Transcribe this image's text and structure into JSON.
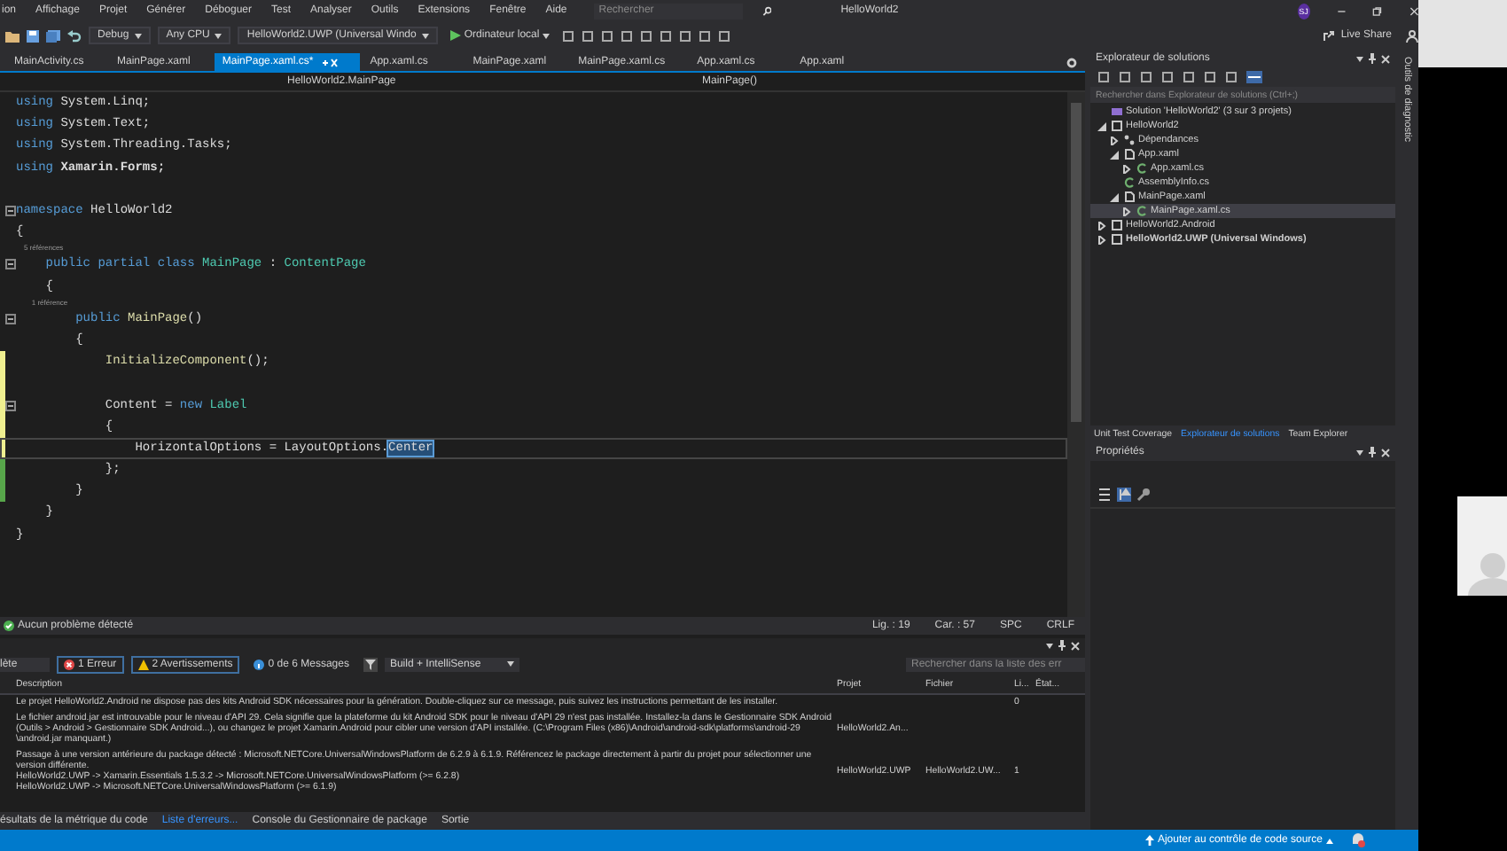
{
  "menu": {
    "items": [
      "ion",
      "Affichage",
      "Projet",
      "Générer",
      "Déboguer",
      "Test",
      "Analyser",
      "Outils",
      "Extensions",
      "Fenêtre",
      "Aide"
    ],
    "search": {
      "placeholder": "Rechercher"
    },
    "solution_name": "HelloWorld2",
    "avatar": "SJ"
  },
  "toolbar": {
    "configuration": "Debug",
    "platform": "Any CPU",
    "startup_project": "HelloWorld2.UWP (Universal Windo",
    "run_target": "Ordinateur local",
    "live_share": "Live Share"
  },
  "editor_tabs": [
    {
      "label": "MainActivity.cs",
      "selected": false
    },
    {
      "label": "MainPage.xaml",
      "selected": false
    },
    {
      "label": "MainPage.xaml.cs*",
      "selected": true
    },
    {
      "label": "App.xaml.cs",
      "selected": false
    },
    {
      "label": "MainPage.xaml",
      "selected": false
    },
    {
      "label": "MainPage.xaml.cs",
      "selected": false
    },
    {
      "label": "App.xaml.cs",
      "selected": false
    },
    {
      "label": "App.xaml",
      "selected": false
    }
  ],
  "navigation": {
    "type": "HelloWorld2.MainPage",
    "member": "MainPage()"
  },
  "code": [
    {
      "kind": "code",
      "fold": false,
      "current": false,
      "modified": false,
      "saved": false,
      "tokens": [
        {
          "kind": "keyword",
          "text": "using"
        },
        {
          "kind": "plain",
          "text": " System.Linq;"
        }
      ]
    },
    {
      "kind": "code",
      "fold": false,
      "current": false,
      "modified": false,
      "saved": false,
      "tokens": [
        {
          "kind": "keyword",
          "text": "using"
        },
        {
          "kind": "plain",
          "text": " System.Text;"
        }
      ]
    },
    {
      "kind": "code",
      "fold": false,
      "current": false,
      "modified": false,
      "saved": false,
      "tokens": [
        {
          "kind": "keyword",
          "text": "using"
        },
        {
          "kind": "plain",
          "text": " System.Threading.Tasks;"
        }
      ]
    },
    {
      "kind": "code",
      "fold": false,
      "current": false,
      "modified": false,
      "saved": false,
      "tokens": [
        {
          "kind": "keyword",
          "text": "using"
        },
        {
          "kind": "bold",
          "text": " Xamarin.Forms;"
        }
      ]
    },
    {
      "kind": "code",
      "fold": false,
      "current": false,
      "modified": false,
      "saved": false
    },
    {
      "kind": "code",
      "fold": true,
      "current": false,
      "modified": false,
      "saved": false,
      "tokens": [
        {
          "kind": "keyword",
          "text": "namespace"
        },
        {
          "kind": "plain",
          "text": " HelloWorld2"
        }
      ]
    },
    {
      "kind": "code",
      "fold": false,
      "current": false,
      "modified": false,
      "saved": false,
      "tokens": [
        {
          "kind": "plain",
          "text": "{"
        }
      ]
    },
    {
      "kind": "hint",
      "fold": false,
      "current": false,
      "modified": false,
      "saved": false,
      "tokens": [
        {
          "kind": "hint",
          "text": "    5 références"
        }
      ]
    },
    {
      "kind": "code",
      "fold": true,
      "current": false,
      "modified": false,
      "saved": false,
      "tokens": [
        {
          "kind": "keyword",
          "text": "    public partial class"
        },
        {
          "kind": "type",
          "text": " MainPage"
        },
        {
          "kind": "plain",
          "text": " : "
        },
        {
          "kind": "type",
          "text": "ContentPage"
        }
      ]
    },
    {
      "kind": "code",
      "fold": false,
      "current": false,
      "modified": false,
      "saved": false,
      "tokens": [
        {
          "kind": "plain",
          "text": "    {"
        }
      ]
    },
    {
      "kind": "hint",
      "fold": false,
      "current": false,
      "modified": false,
      "saved": false,
      "tokens": [
        {
          "kind": "hint",
          "text": "        1 référence"
        }
      ]
    },
    {
      "kind": "code",
      "fold": true,
      "current": false,
      "modified": false,
      "saved": false,
      "tokens": [
        {
          "kind": "keyword",
          "text": "        public"
        },
        {
          "kind": "method",
          "text": " MainPage"
        },
        {
          "kind": "plain",
          "text": "()"
        }
      ]
    },
    {
      "kind": "code",
      "fold": false,
      "current": false,
      "modified": false,
      "saved": false,
      "tokens": [
        {
          "kind": "plain",
          "text": "        {"
        }
      ]
    },
    {
      "kind": "code",
      "fold": false,
      "current": false,
      "modified": true,
      "saved": false,
      "tokens": [
        {
          "kind": "method",
          "text": "            InitializeComponent"
        },
        {
          "kind": "plain",
          "text": "();"
        }
      ]
    },
    {
      "kind": "code",
      "fold": false,
      "current": false,
      "modified": true,
      "saved": false
    },
    {
      "kind": "code",
      "fold": true,
      "current": false,
      "modified": true,
      "saved": false,
      "tokens": [
        {
          "kind": "plain",
          "text": "            Content = "
        },
        {
          "kind": "keyword",
          "text": "new"
        },
        {
          "kind": "type",
          "text": " Label"
        }
      ]
    },
    {
      "kind": "code",
      "fold": false,
      "current": false,
      "modified": true,
      "saved": false,
      "tokens": [
        {
          "kind": "plain",
          "text": "            {"
        }
      ]
    },
    {
      "kind": "code",
      "fold": false,
      "current": true,
      "modified": true,
      "saved": false,
      "tokens": [
        {
          "kind": "plain",
          "text": "                HorizontalOptions = LayoutOptions."
        },
        {
          "kind": "selected",
          "text": "Center"
        }
      ]
    },
    {
      "kind": "code",
      "fold": false,
      "current": false,
      "modified": false,
      "saved": true,
      "tokens": [
        {
          "kind": "plain",
          "text": "            };"
        }
      ]
    },
    {
      "kind": "code",
      "fold": false,
      "current": false,
      "modified": false,
      "saved": true,
      "tokens": [
        {
          "kind": "plain",
          "text": "        }"
        }
      ]
    },
    {
      "kind": "code",
      "fold": false,
      "current": false,
      "modified": false,
      "saved": false,
      "tokens": [
        {
          "kind": "plain",
          "text": "    }"
        }
      ]
    },
    {
      "kind": "code",
      "fold": false,
      "current": false,
      "modified": false,
      "saved": false,
      "tokens": [
        {
          "kind": "plain",
          "text": "}"
        }
      ]
    }
  ],
  "editor_status": {
    "issues": "Aucun problème détecté",
    "line": "Lig. : 19",
    "column": "Car. : 57",
    "whitespace": "SPC",
    "line_endings": "CRLF"
  },
  "error_list": {
    "scope": "lète",
    "errors": "1 Erreur",
    "warnings": "2 Avertissements",
    "messages": "0 de 6 Messages",
    "source": "Build + IntelliSense",
    "search": {
      "placeholder": "Rechercher dans la liste des err"
    },
    "columns": [
      "Description",
      "Projet",
      "Fichier",
      "Li...",
      "État..."
    ],
    "rows": [
      {
        "lines": [
          "Le projet HelloWorld2.Android ne dispose pas des kits Android SDK nécessaires pour la génération. Double-cliquez sur ce message, puis suivez les instructions permettant de les installer."
        ],
        "line": "0"
      },
      {
        "lines": [
          "Le fichier android.jar est introuvable pour le niveau d'API 29. Cela signifie que la plateforme du kit Android SDK pour le niveau d'API 29 n'est pas installée. Installez-la dans le Gestionnaire SDK Android",
          "(Outils > Android > Gestionnaire SDK Android...), ou changez le projet Xamarin.Android pour cibler une version d'API installée. (C:\\Program Files (x86)\\Android\\android-sdk\\platforms\\android-29",
          "\\android.jar manquant.)"
        ],
        "project": "HelloWorld2.An..."
      },
      {
        "lines": [
          "Passage à une version antérieure du package détecté : Microsoft.NETCore.UniversalWindowsPlatform de 6.2.9 à 6.1.9. Référencez le package directement à partir du projet pour sélectionner une",
          "version différente.",
          "HelloWorld2.UWP -> Xamarin.Essentials 1.5.3.2 -> Microsoft.NETCore.UniversalWindowsPlatform (>= 6.2.8)",
          "HelloWorld2.UWP -> Microsoft.NETCore.UniversalWindowsPlatform (>= 6.1.9)"
        ],
        "project": "HelloWorld2.UWP",
        "file": "HelloWorld2.UW...",
        "line": "1"
      }
    ]
  },
  "bottom_tabs": [
    {
      "label": "ésultats de la métrique du code",
      "selected": false
    },
    {
      "label": "Liste d'erreurs...",
      "selected": true
    },
    {
      "label": "Console du Gestionnaire de package",
      "selected": false
    },
    {
      "label": "Sortie",
      "selected": false
    }
  ],
  "solution_explorer": {
    "title": "Explorateur de solutions",
    "search": {
      "placeholder": "Rechercher dans Explorateur de solutions (Ctrl+;)"
    },
    "tree": [
      {
        "label": "Solution 'HelloWorld2' (3 sur 3 projets)",
        "kind": "solution",
        "selected": false,
        "startup": false
      },
      {
        "label": "HelloWorld2",
        "kind": "project",
        "expanded": true,
        "selected": false,
        "startup": false,
        "children": [
          {
            "label": "Dépendances",
            "kind": "dependencies",
            "expanded": false,
            "selected": false,
            "startup": false
          },
          {
            "label": "App.xaml",
            "kind": "xaml",
            "expanded": true,
            "selected": false,
            "startup": false,
            "children": [
              {
                "label": "App.xaml.cs",
                "kind": "cs",
                "expanded": false,
                "selected": false,
                "startup": false
              }
            ]
          },
          {
            "label": "AssemblyInfo.cs",
            "kind": "cs",
            "selected": false,
            "startup": false
          },
          {
            "label": "MainPage.xaml",
            "kind": "xaml",
            "expanded": true,
            "selected": false,
            "startup": false,
            "children": [
              {
                "label": "MainPage.xaml.cs",
                "kind": "cs",
                "expanded": false,
                "selected": true,
                "startup": false
              }
            ]
          }
        ]
      },
      {
        "label": "HelloWorld2.Android",
        "kind": "project",
        "expanded": false,
        "selected": false,
        "startup": false
      },
      {
        "label": "HelloWorld2.UWP (Universal Windows)",
        "kind": "project",
        "expanded": false,
        "selected": false,
        "startup": true
      }
    ],
    "tabs": [
      {
        "label": "Unit Test Coverage",
        "selected": false
      },
      {
        "label": "Explorateur de solutions",
        "selected": true
      },
      {
        "label": "Team Explorer",
        "selected": false
      }
    ]
  },
  "properties": {
    "title": "Propriétés"
  },
  "diagnostics_tab": "Outils de diagnostic",
  "status_bar": {
    "source_control": "Ajouter au contrôle de code source"
  }
}
